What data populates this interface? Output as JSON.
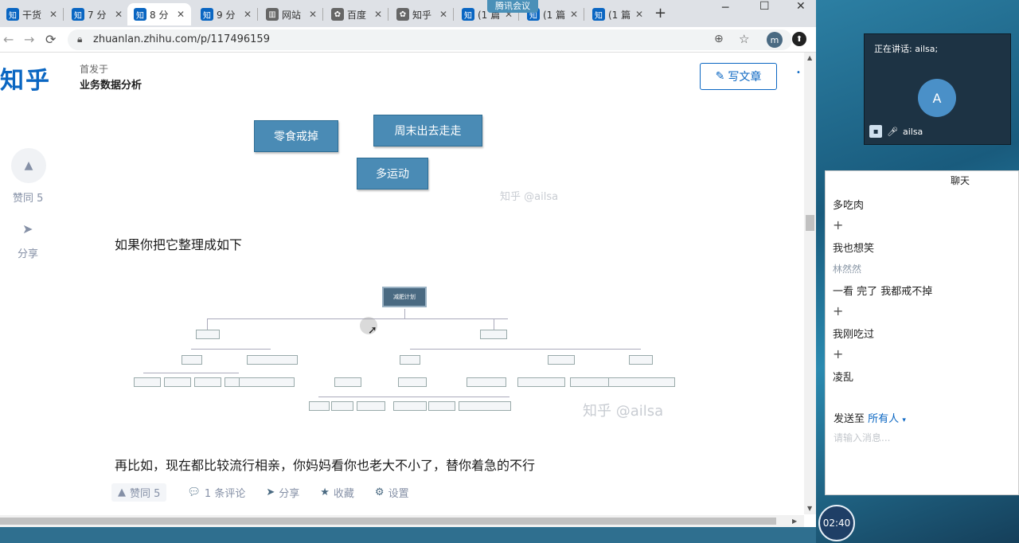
{
  "browser": {
    "tabs": [
      {
        "label": "干货",
        "icon": "知"
      },
      {
        "label": "7 分",
        "icon": "知"
      },
      {
        "label": "8 分",
        "icon": "知",
        "active": true
      },
      {
        "label": "9 分",
        "icon": "知"
      },
      {
        "label": "网站",
        "icon": "chart-icon"
      },
      {
        "label": "百度",
        "icon": "paw-icon"
      },
      {
        "label": "知乎",
        "icon": "paw-icon"
      },
      {
        "label": "(1 篇",
        "icon": "知"
      },
      {
        "label": "(1 篇",
        "icon": "知"
      },
      {
        "label": "(1 篇",
        "icon": "知"
      }
    ],
    "meeting_banner": "腾讯会议",
    "url": "zhuanlan.zhihu.com/p/117496159",
    "profile_initial": "m"
  },
  "article": {
    "logo": "知乎",
    "first_published": "首发于",
    "column": "业务数据分析",
    "write_button": "写文章",
    "vote_label": "赞同 5",
    "share_label": "分享",
    "boxes": [
      "零食戒掉",
      "周末出去走走",
      "多运动"
    ],
    "watermark_small": "知乎 @ailsa",
    "para1": "如果你把它整理成如下",
    "tree_root": "减肥计划",
    "tree_watermark": "知乎 @ailsa",
    "para2": "再比如，现在都比较流行相亲，你妈妈看你也老大不小了，替你着急的不行",
    "actions": {
      "vote": "赞同 5",
      "comments": "1 条评论",
      "share": "分享",
      "collect": "收藏",
      "settings": "设置"
    }
  },
  "meeting": {
    "speaking": "正在讲话: ailsa;",
    "avatar_initial": "A",
    "user": "ailsa",
    "chat_title": "聊天",
    "messages": [
      {
        "text": "多吃肉",
        "type": "msg"
      },
      {
        "text": "+",
        "type": "msg"
      },
      {
        "text": "我也想笑",
        "type": "msg"
      },
      {
        "text": "林然然",
        "type": "name"
      },
      {
        "text": "一看 完了 我都戒不掉",
        "type": "msg"
      },
      {
        "text": "+",
        "type": "msg"
      },
      {
        "text": "我刚吃过",
        "type": "msg"
      },
      {
        "text": "+",
        "type": "msg"
      },
      {
        "text": "凌乱",
        "type": "msg"
      }
    ],
    "send_to": "发送至",
    "send_target": "所有人",
    "input_placeholder": "请输入消息...",
    "timer": "02:40"
  }
}
